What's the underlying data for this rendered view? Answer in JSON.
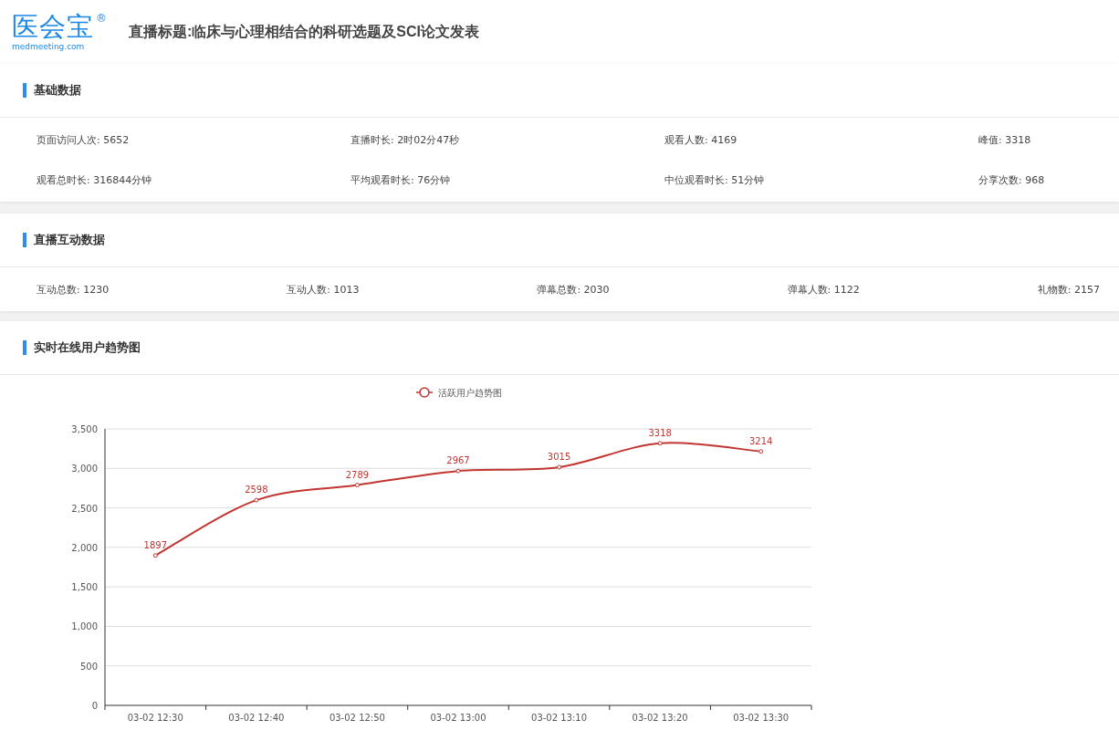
{
  "header": {
    "logo": {
      "name": "医会宝",
      "mark": "®",
      "domain": "medmeeting.com"
    },
    "title": "直播标题:临床与心理相结合的科研选题及SCI论文发表"
  },
  "sections": [
    {
      "kind": "stats",
      "title": "基础数据",
      "items": [
        {
          "text": "页面访问人次: 5652"
        },
        {
          "text": "直播时长: 2时02分47秒"
        },
        {
          "text": "观看人数: 4169"
        },
        {
          "text": "峰值: 3318"
        },
        {
          "text": "观看总时长: 316844分钟"
        },
        {
          "text": "平均观看时长: 76分钟"
        },
        {
          "text": "中位观看时长: 51分钟"
        },
        {
          "text": "分享次数: 968"
        }
      ]
    },
    {
      "kind": "row",
      "title": "直播互动数据",
      "items": [
        {
          "text": "互动总数: 1230"
        },
        {
          "text": "互动人数: 1013"
        },
        {
          "text": "弹幕总数: 2030"
        },
        {
          "text": "弹幕人数: 1122"
        },
        {
          "text": "礼物数: 2157"
        }
      ]
    },
    {
      "kind": "chart",
      "title": "实时在线用户趋势图",
      "chart_data": {
        "type": "line",
        "categories": [
          "03-02 12:30",
          "03-02 12:40",
          "03-02 12:50",
          "03-02 13:00",
          "03-02 13:10",
          "03-02 13:20",
          "03-02 13:30"
        ],
        "series": [
          {
            "name": "活跃用户趋势图",
            "color": "#c23531",
            "marker": "circle",
            "values": [
              1897,
              2598,
              2789,
              2967,
              3015,
              3318,
              3214
            ]
          }
        ],
        "grid": true,
        "ylim": [
          0,
          3500
        ],
        "yticks": [
          {
            "value": 0,
            "label": "0"
          },
          {
            "value": 500,
            "label": "500"
          },
          {
            "value": 1000,
            "label": "1,000"
          },
          {
            "value": 1500,
            "label": "1,500"
          },
          {
            "value": 2000,
            "label": "2,000"
          },
          {
            "value": 2500,
            "label": "2,500"
          },
          {
            "value": 3000,
            "label": "3,000"
          },
          {
            "value": 3500,
            "label": "3,500"
          }
        ],
        "data_labels": true
      }
    }
  ]
}
